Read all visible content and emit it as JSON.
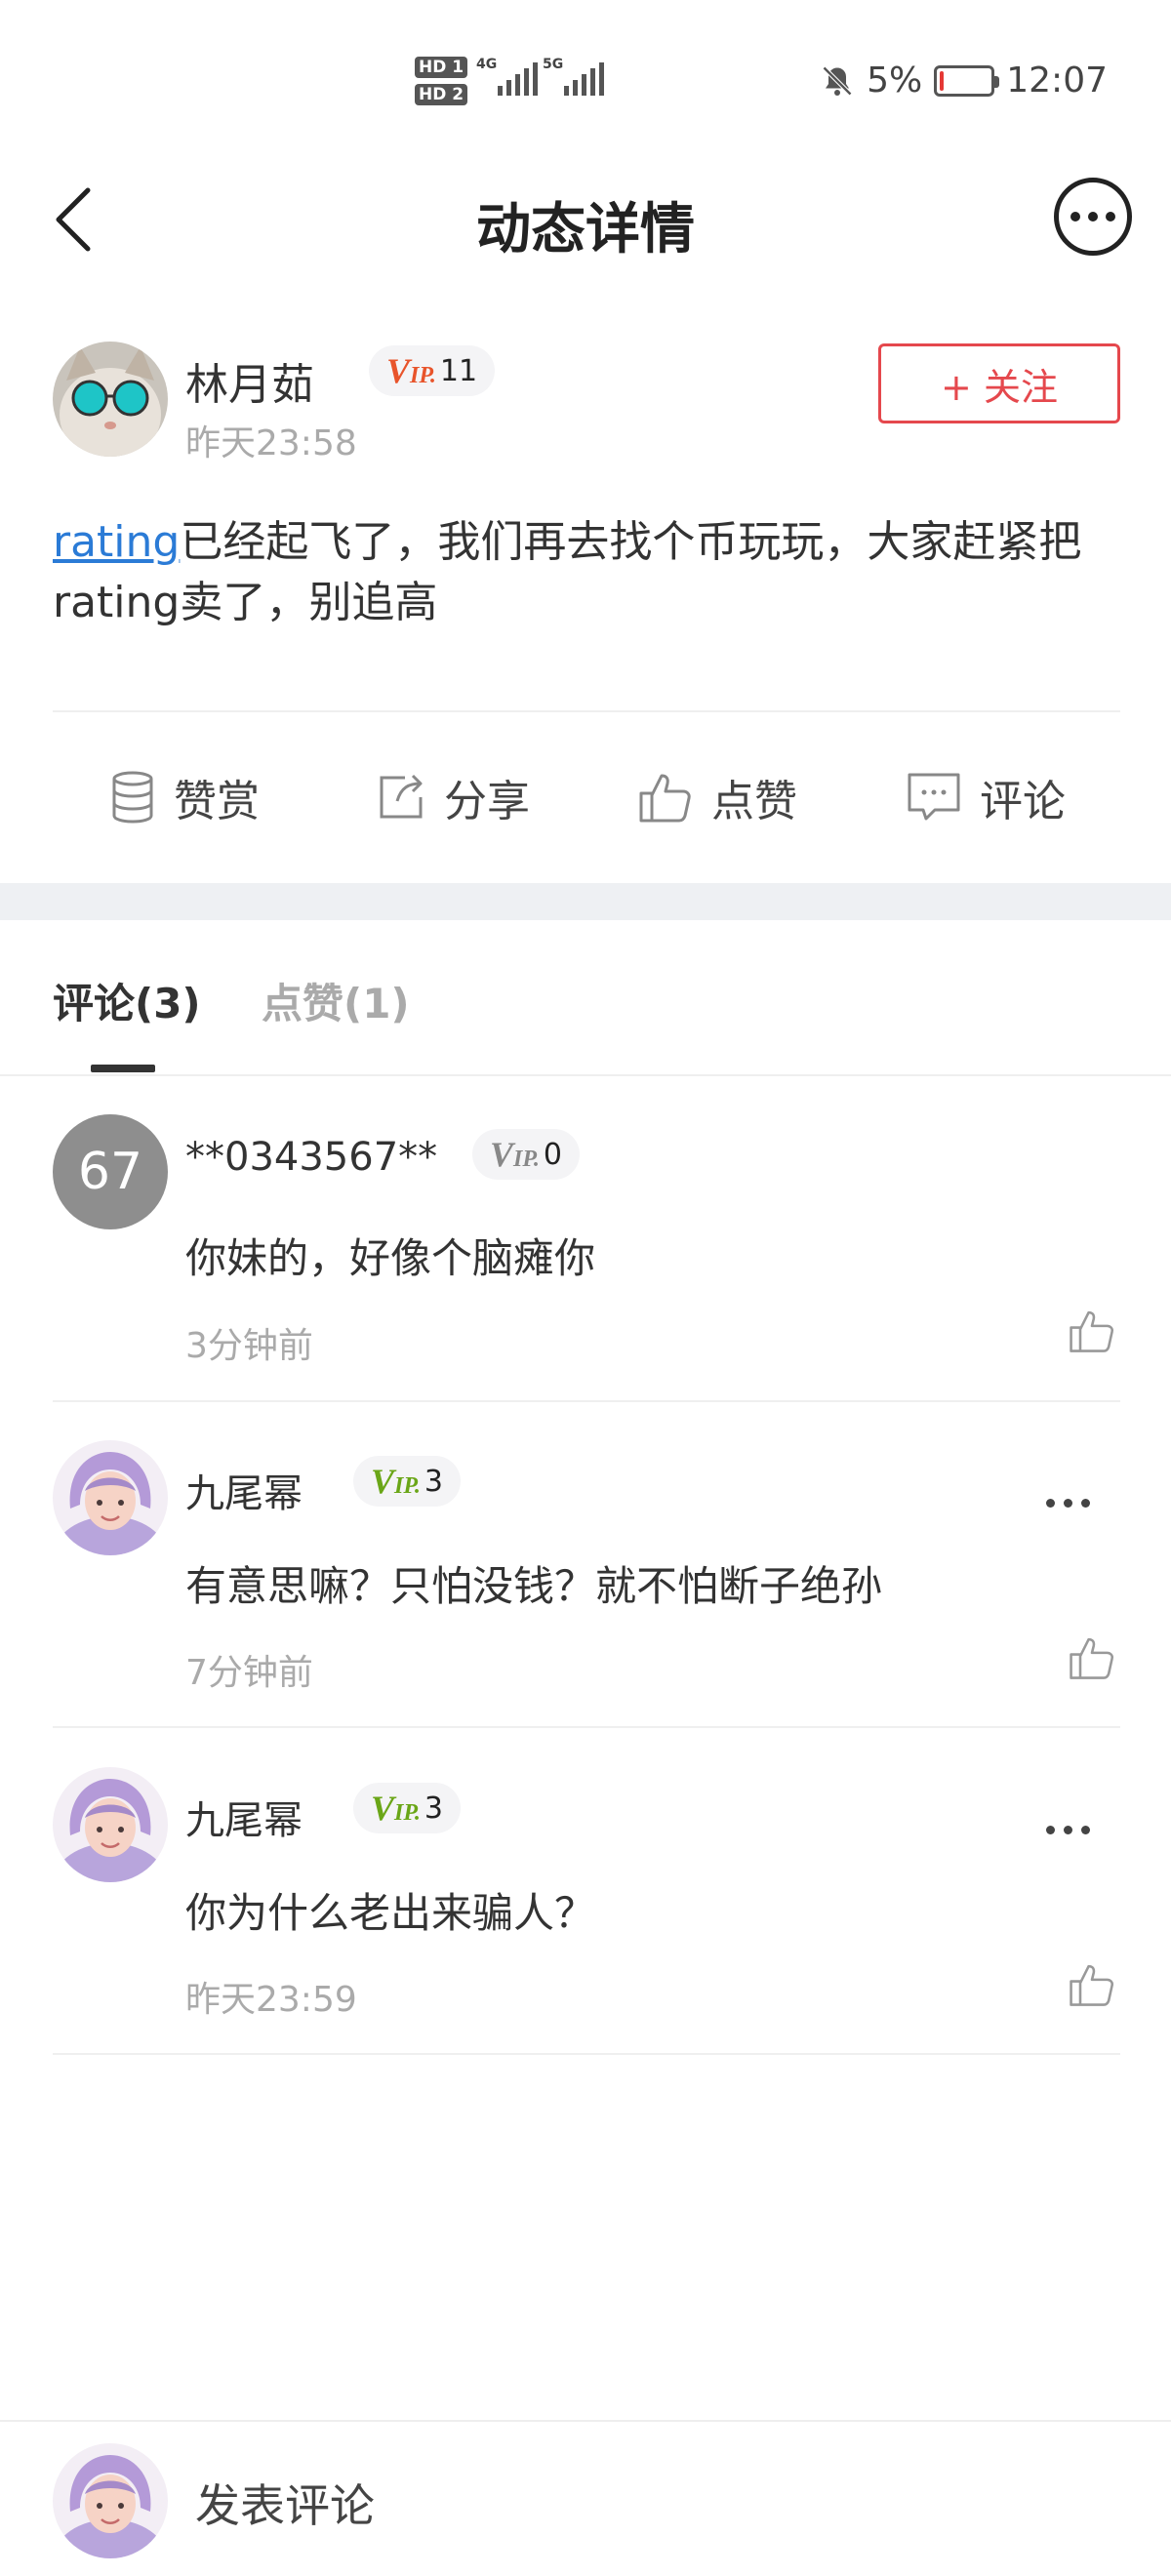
{
  "status_bar": {
    "sim1": "HD 1",
    "sim2": "HD 2",
    "net1": "4G",
    "net2": "5G",
    "battery": "5%",
    "battery_level": 0.05,
    "time": "12:07"
  },
  "header": {
    "title": "动态详情"
  },
  "post": {
    "author": "林月茹",
    "vip_level": "11",
    "time": "昨天23:58",
    "follow_label": "+ 关注",
    "content_link": "rating",
    "content_text": "已经起飞了，我们再去找个币玩玩，大家赶紧把rating卖了，别追高"
  },
  "actions": {
    "reward": "赞赏",
    "share": "分享",
    "like": "点赞",
    "comment": "评论"
  },
  "tabs": {
    "comments": "评论(3)",
    "likes": "点赞(1)"
  },
  "comments": [
    {
      "avatar_text": "67",
      "name": "**0343567**",
      "vip_level": "0",
      "text": "你妹的，好像个脑瘫你",
      "time": "3分钟前"
    },
    {
      "name": "九尾幂",
      "vip_level": "3",
      "text": "有意思嘛？只怕没钱？就不怕断子绝孙",
      "time": "7分钟前"
    },
    {
      "name": "九尾幂",
      "vip_level": "3",
      "text": "你为什么老出来骗人？",
      "time": "昨天23:59"
    }
  ],
  "bottom_bar": {
    "placeholder": "发表评论"
  },
  "colors": {
    "accent_red": "#e5484d",
    "link_blue": "#2b7bd6",
    "vip_orange": "#e8542b",
    "vip_green": "#6aa617",
    "vip_gray": "#888888"
  }
}
